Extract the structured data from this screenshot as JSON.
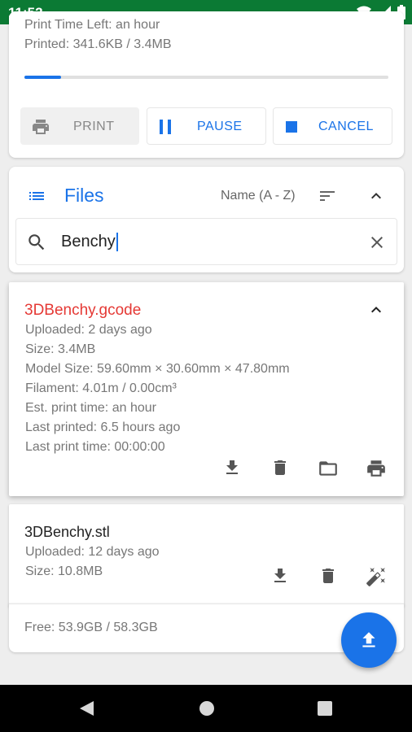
{
  "status_bar": {
    "time": "11:52"
  },
  "print_job": {
    "time_left_line": "Print Time Left: an hour",
    "printed_line": "Printed: 341.6KB / 3.4MB",
    "progress": 0.1,
    "print_label": "PRINT",
    "pause_label": "PAUSE",
    "cancel_label": "CANCEL"
  },
  "files": {
    "title": "Files",
    "sort_label": "Name (A - Z)",
    "search_value": "Benchy",
    "items": [
      {
        "name": "3DBenchy.gcode",
        "uploaded": "Uploaded: 2 days ago",
        "size": "Size: 3.4MB",
        "model_size": "Model Size: 59.60mm × 30.60mm × 47.80mm",
        "filament": "Filament: 4.01m / 0.00cm³",
        "est_time": "Est. print time: an hour",
        "last_printed": "Last printed: 6.5 hours ago",
        "last_print_time": "Last print time: 00:00:00"
      },
      {
        "name": "3DBenchy.stl",
        "uploaded": "Uploaded: 12 days ago",
        "size": "Size: 10.8MB"
      }
    ],
    "free_space": "Free: 53.9GB / 58.3GB"
  },
  "colors": {
    "accent": "#1a73e8",
    "selected_file": "#e53935",
    "status_bar": "#0b7a34"
  }
}
